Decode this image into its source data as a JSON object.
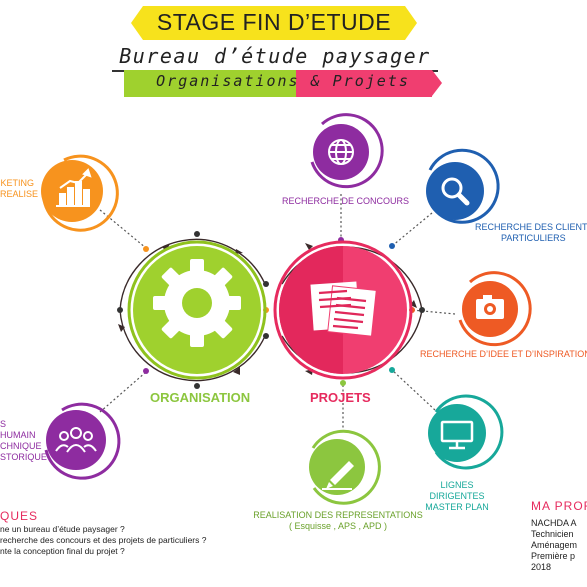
{
  "header": {
    "title": "STAGE FIN D’ETUDE",
    "subtitle": "Bureau d’étude paysager",
    "subtitle2": "Organisations & Projets"
  },
  "main": {
    "organisation_label": "ORGANISATION",
    "projets_label": "PROJETS"
  },
  "nodes": {
    "marketing": [
      "KETING",
      "REALISE"
    ],
    "concours": "RECHERCHE DE CONCOURS",
    "clients": [
      "RECHERCHE DES CLIENTS P",
      "PARTICULIERS"
    ],
    "idee": "RECHERCHE D’IDEE ET D’INSPIRATION",
    "lignes": [
      "LIGNES DIRIGENTES",
      "MASTER PLAN"
    ],
    "realisation": [
      "REALISATION DES REPRESENTATIONS",
      "( Esquisse , APS , APD )"
    ],
    "humain": [
      "S HUMAIN",
      "CHNIQUE",
      "STORIQUE"
    ]
  },
  "problematiques": {
    "heading": "QUES",
    "lines": [
      "ne un bureau d’étude paysager ?",
      "recherche des concours et des projets de particuliers ?",
      "nte la conception final du projet ?"
    ]
  },
  "profile": {
    "heading": "MA PROF",
    "lines": [
      "NACHDA A",
      "Technicien",
      "Aménagem",
      "Première p",
      "2018"
    ]
  },
  "colors": {
    "yellow": "#f7e21c",
    "green": "#9fd12e",
    "pink": "#f03e70",
    "orange": "#f7931e",
    "purple": "#8e2ca0",
    "blue": "#1f5fb0",
    "red_orange": "#ee5a24",
    "teal": "#17a89a",
    "lime": "#8cc63f"
  }
}
